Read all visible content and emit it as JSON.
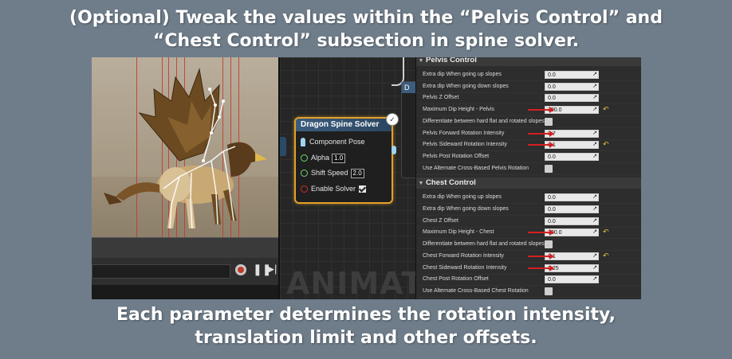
{
  "caption_top": {
    "line1": "(Optional) Tweak the values within the “Pelvis Control” and",
    "line2": "“Chest  Control” subsection in spine solver."
  },
  "caption_bottom": {
    "line1": "Each parameter determines the rotation intensity,",
    "line2": "translation limit and other offsets."
  },
  "graph": {
    "watermark": "ANIMATI",
    "node": {
      "title": "Dragon Spine Solver",
      "component_pose": "Component Pose",
      "alpha_label": "Alpha",
      "alpha_value": "1.0",
      "shift_speed_label": "Shift Speed",
      "shift_speed_value": "2.0",
      "enable_solver_label": "Enable Solver",
      "enable_solver_checked": true
    },
    "right_node_header": "D"
  },
  "details": {
    "pelvis": {
      "header": "Pelvis Control",
      "rows": [
        {
          "label": "Extra dip When going up slopes",
          "value": "0.0",
          "type": "field"
        },
        {
          "label": "Extra dip When going down slopes",
          "value": "0.0",
          "type": "field"
        },
        {
          "label": "Pelvis Z Offset",
          "value": "0.0",
          "type": "field"
        },
        {
          "label": "Maximum Dip Height - Pelvis",
          "value": "300.0",
          "type": "field",
          "arrow": true,
          "reset": true
        },
        {
          "label": "Differentiate between hard flat and rotated slopes",
          "type": "checkbox"
        },
        {
          "label": "Pelvis Forward Rotation Intensity",
          "value": "0.7",
          "type": "field",
          "arrow": true
        },
        {
          "label": "Pelvis Sideward Rotation Intensity",
          "value": "0.1",
          "type": "field",
          "arrow": true,
          "reset": true
        },
        {
          "label": "Pelvis Post Rotation Offset",
          "value": "0.0",
          "type": "field"
        },
        {
          "label": "Use Alternate Cross-Based Pelvis Rotation",
          "type": "checkbox"
        }
      ]
    },
    "chest": {
      "header": "Chest Control",
      "rows": [
        {
          "label": "Extra dip When going up slopes",
          "value": "0.0",
          "type": "field"
        },
        {
          "label": "Extra dip When going down slopes",
          "value": "0.0",
          "type": "field"
        },
        {
          "label": "Chest Z Offset",
          "value": "0.0",
          "type": "field"
        },
        {
          "label": "Maximum Dip Height - Chest",
          "value": "300.0",
          "type": "field",
          "arrow": true,
          "reset": true
        },
        {
          "label": "Differentiate between hard flat and rotated slopes",
          "type": "checkbox"
        },
        {
          "label": "Chest Forward Rotation Intensity",
          "value": "0.1",
          "type": "field",
          "arrow": true,
          "reset": true
        },
        {
          "label": "Chest Sideward Rotation Intensity",
          "value": "0.25",
          "type": "field",
          "arrow": true
        },
        {
          "label": "Chest Post Rotation Offset",
          "value": "0.0",
          "type": "field"
        },
        {
          "label": "Use Alternate Cross-Based Chest Rotation",
          "type": "checkbox"
        }
      ]
    }
  },
  "colors": {
    "node_border": "#e3a12a",
    "annotation_arrow": "#d41f1f",
    "reset_icon": "#e6c23a"
  }
}
